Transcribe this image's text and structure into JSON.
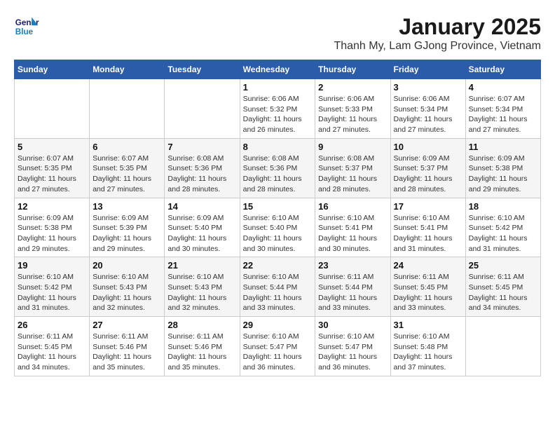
{
  "logo": {
    "line1": "General",
    "line2": "Blue"
  },
  "title": "January 2025",
  "location": "Thanh My, Lam GJong Province, Vietnam",
  "weekdays": [
    "Sunday",
    "Monday",
    "Tuesday",
    "Wednesday",
    "Thursday",
    "Friday",
    "Saturday"
  ],
  "weeks": [
    [
      {
        "day": "",
        "info": ""
      },
      {
        "day": "",
        "info": ""
      },
      {
        "day": "",
        "info": ""
      },
      {
        "day": "1",
        "info": "Sunrise: 6:06 AM\nSunset: 5:32 PM\nDaylight: 11 hours\nand 26 minutes."
      },
      {
        "day": "2",
        "info": "Sunrise: 6:06 AM\nSunset: 5:33 PM\nDaylight: 11 hours\nand 27 minutes."
      },
      {
        "day": "3",
        "info": "Sunrise: 6:06 AM\nSunset: 5:34 PM\nDaylight: 11 hours\nand 27 minutes."
      },
      {
        "day": "4",
        "info": "Sunrise: 6:07 AM\nSunset: 5:34 PM\nDaylight: 11 hours\nand 27 minutes."
      }
    ],
    [
      {
        "day": "5",
        "info": "Sunrise: 6:07 AM\nSunset: 5:35 PM\nDaylight: 11 hours\nand 27 minutes."
      },
      {
        "day": "6",
        "info": "Sunrise: 6:07 AM\nSunset: 5:35 PM\nDaylight: 11 hours\nand 27 minutes."
      },
      {
        "day": "7",
        "info": "Sunrise: 6:08 AM\nSunset: 5:36 PM\nDaylight: 11 hours\nand 28 minutes."
      },
      {
        "day": "8",
        "info": "Sunrise: 6:08 AM\nSunset: 5:36 PM\nDaylight: 11 hours\nand 28 minutes."
      },
      {
        "day": "9",
        "info": "Sunrise: 6:08 AM\nSunset: 5:37 PM\nDaylight: 11 hours\nand 28 minutes."
      },
      {
        "day": "10",
        "info": "Sunrise: 6:09 AM\nSunset: 5:37 PM\nDaylight: 11 hours\nand 28 minutes."
      },
      {
        "day": "11",
        "info": "Sunrise: 6:09 AM\nSunset: 5:38 PM\nDaylight: 11 hours\nand 29 minutes."
      }
    ],
    [
      {
        "day": "12",
        "info": "Sunrise: 6:09 AM\nSunset: 5:38 PM\nDaylight: 11 hours\nand 29 minutes."
      },
      {
        "day": "13",
        "info": "Sunrise: 6:09 AM\nSunset: 5:39 PM\nDaylight: 11 hours\nand 29 minutes."
      },
      {
        "day": "14",
        "info": "Sunrise: 6:09 AM\nSunset: 5:40 PM\nDaylight: 11 hours\nand 30 minutes."
      },
      {
        "day": "15",
        "info": "Sunrise: 6:10 AM\nSunset: 5:40 PM\nDaylight: 11 hours\nand 30 minutes."
      },
      {
        "day": "16",
        "info": "Sunrise: 6:10 AM\nSunset: 5:41 PM\nDaylight: 11 hours\nand 30 minutes."
      },
      {
        "day": "17",
        "info": "Sunrise: 6:10 AM\nSunset: 5:41 PM\nDaylight: 11 hours\nand 31 minutes."
      },
      {
        "day": "18",
        "info": "Sunrise: 6:10 AM\nSunset: 5:42 PM\nDaylight: 11 hours\nand 31 minutes."
      }
    ],
    [
      {
        "day": "19",
        "info": "Sunrise: 6:10 AM\nSunset: 5:42 PM\nDaylight: 11 hours\nand 31 minutes."
      },
      {
        "day": "20",
        "info": "Sunrise: 6:10 AM\nSunset: 5:43 PM\nDaylight: 11 hours\nand 32 minutes."
      },
      {
        "day": "21",
        "info": "Sunrise: 6:10 AM\nSunset: 5:43 PM\nDaylight: 11 hours\nand 32 minutes."
      },
      {
        "day": "22",
        "info": "Sunrise: 6:10 AM\nSunset: 5:44 PM\nDaylight: 11 hours\nand 33 minutes."
      },
      {
        "day": "23",
        "info": "Sunrise: 6:11 AM\nSunset: 5:44 PM\nDaylight: 11 hours\nand 33 minutes."
      },
      {
        "day": "24",
        "info": "Sunrise: 6:11 AM\nSunset: 5:45 PM\nDaylight: 11 hours\nand 33 minutes."
      },
      {
        "day": "25",
        "info": "Sunrise: 6:11 AM\nSunset: 5:45 PM\nDaylight: 11 hours\nand 34 minutes."
      }
    ],
    [
      {
        "day": "26",
        "info": "Sunrise: 6:11 AM\nSunset: 5:45 PM\nDaylight: 11 hours\nand 34 minutes."
      },
      {
        "day": "27",
        "info": "Sunrise: 6:11 AM\nSunset: 5:46 PM\nDaylight: 11 hours\nand 35 minutes."
      },
      {
        "day": "28",
        "info": "Sunrise: 6:11 AM\nSunset: 5:46 PM\nDaylight: 11 hours\nand 35 minutes."
      },
      {
        "day": "29",
        "info": "Sunrise: 6:10 AM\nSunset: 5:47 PM\nDaylight: 11 hours\nand 36 minutes."
      },
      {
        "day": "30",
        "info": "Sunrise: 6:10 AM\nSunset: 5:47 PM\nDaylight: 11 hours\nand 36 minutes."
      },
      {
        "day": "31",
        "info": "Sunrise: 6:10 AM\nSunset: 5:48 PM\nDaylight: 11 hours\nand 37 minutes."
      },
      {
        "day": "",
        "info": ""
      }
    ]
  ]
}
